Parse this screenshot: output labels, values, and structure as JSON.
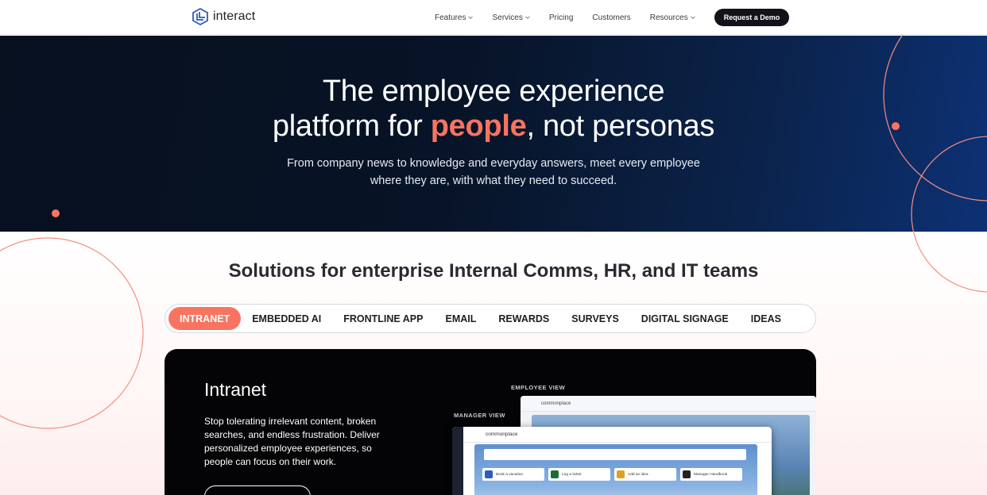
{
  "nav": {
    "logo_text": "interact",
    "items": [
      {
        "label": "Features",
        "dropdown": true
      },
      {
        "label": "Services",
        "dropdown": true
      },
      {
        "label": "Pricing",
        "dropdown": false
      },
      {
        "label": "Customers",
        "dropdown": false
      },
      {
        "label": "Resources",
        "dropdown": true
      }
    ],
    "cta_label": "Request a Demo"
  },
  "hero": {
    "title_line1": "The employee experience",
    "title_line2_pre": "platform for ",
    "title_highlight": "people",
    "title_line2_post": ", not personas",
    "subtitle_line1": "From company news to knowledge and everyday answers, meet every employee",
    "subtitle_line2": "where they are, with what they need to succeed."
  },
  "solutions": {
    "title_pre": "Solutions for ",
    "title_bold": "enterprise",
    "title_post": " Internal Comms, HR, and IT teams",
    "tabs": [
      "INTRANET",
      "EMBEDDED AI",
      "FRONTLINE APP",
      "EMAIL",
      "REWARDS",
      "SURVEYS",
      "DIGITAL SIGNAGE",
      "IDEAS"
    ],
    "active_tab": "INTRANET"
  },
  "card": {
    "title": "Intranet",
    "body": "Stop tolerating irrelevant content, broken searches, and endless frustration. Deliver personalized employee experiences, so people can focus on their work.",
    "employee_view_label": "EMPLOYEE VIEW",
    "manager_view_label": "MANAGER VIEW",
    "app_brand": "commonplace",
    "tiles": [
      "Book a vacation",
      "Log a ticket",
      "Add an idea",
      "Manager Handbook"
    ]
  },
  "colors": {
    "accent": "#f87461",
    "nav_button": "#12121a",
    "hero_dark": "#07101f",
    "hero_blue": "#0c3174"
  }
}
